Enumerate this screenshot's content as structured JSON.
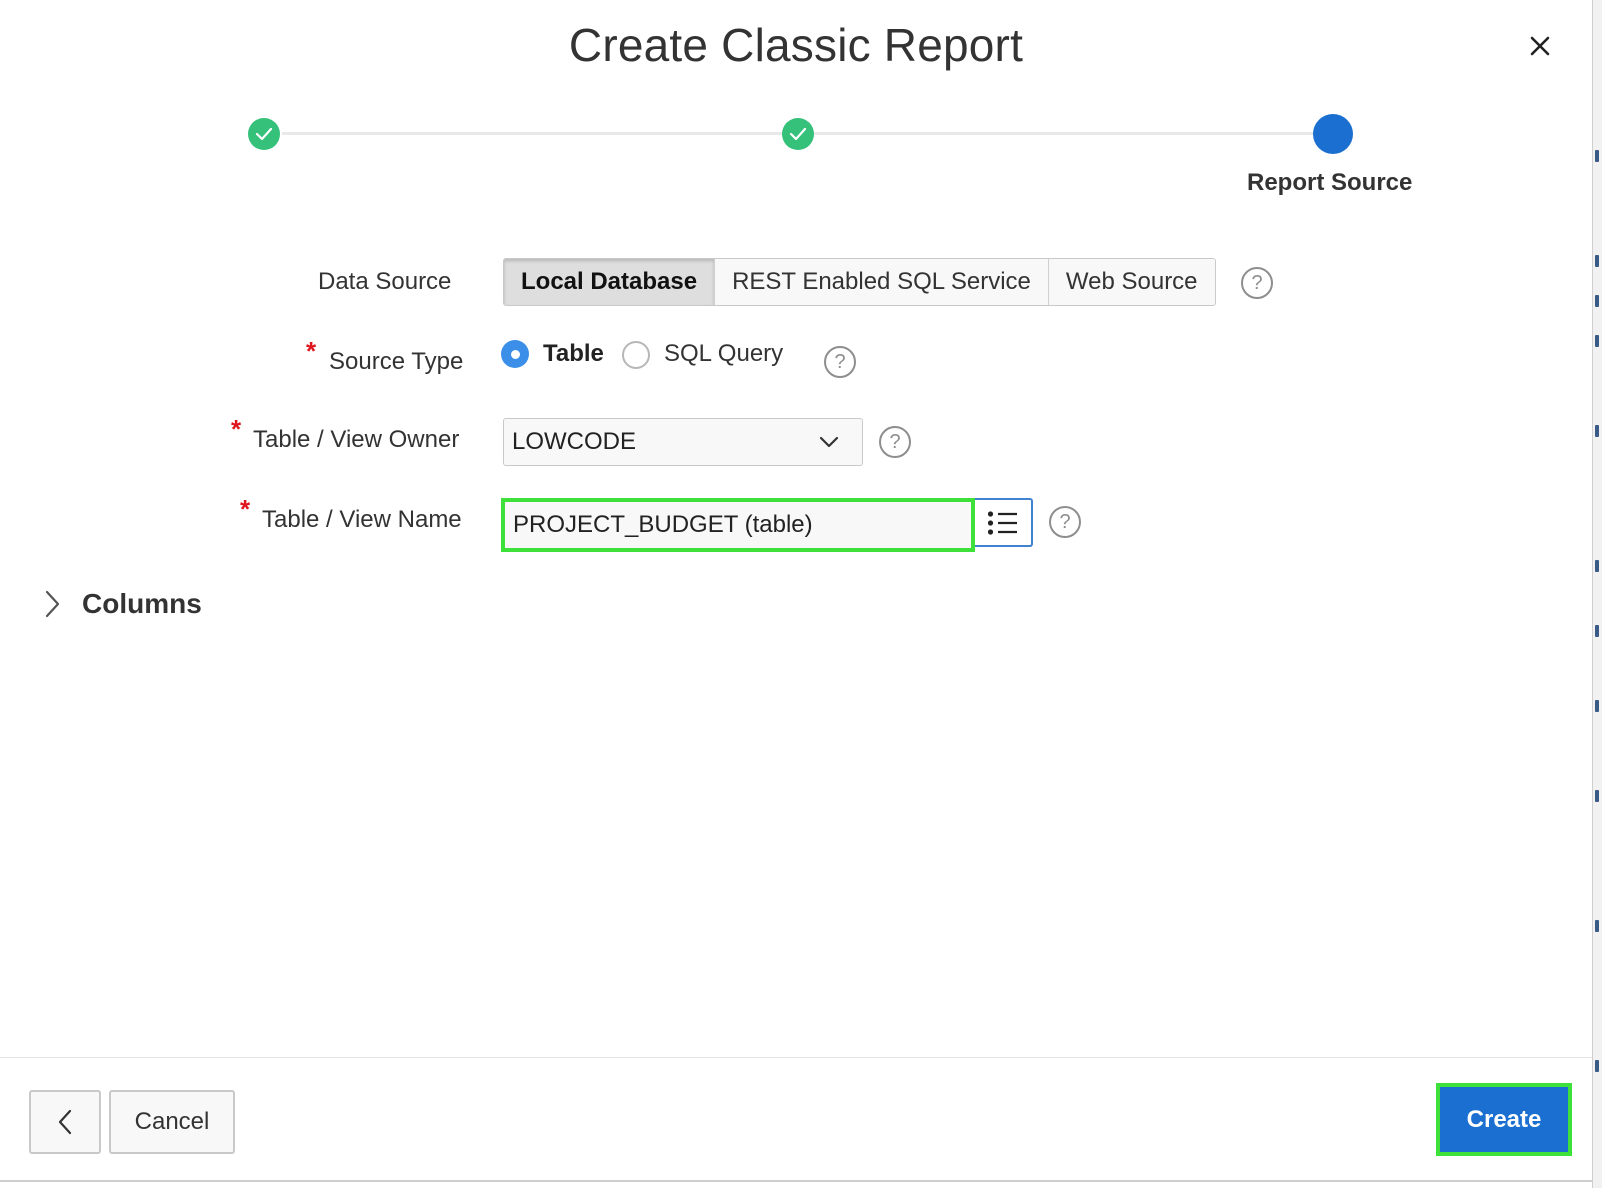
{
  "dialog": {
    "title": "Create Classic Report",
    "close_icon": "close-icon"
  },
  "wizard": {
    "steps": [
      {
        "status": "complete"
      },
      {
        "status": "complete"
      },
      {
        "status": "current",
        "label": "Report Source"
      }
    ],
    "complete_color": "#35c17a",
    "current_color": "#1a6fd0"
  },
  "form": {
    "data_source": {
      "label": "Data Source",
      "options": [
        "Local Database",
        "REST Enabled SQL Service",
        "Web Source"
      ],
      "selected": "Local Database"
    },
    "source_type": {
      "label": "Source Type",
      "required": true,
      "required_mark": "*",
      "options": [
        "Table",
        "SQL Query"
      ],
      "selected": "Table"
    },
    "owner": {
      "label": "Table / View Owner",
      "required": true,
      "required_mark": "*",
      "value": "LOWCODE"
    },
    "name": {
      "label": "Table / View Name",
      "required": true,
      "required_mark": "*",
      "value": "PROJECT_BUDGET (table)"
    },
    "help_glyph": "?"
  },
  "columns_section": {
    "label": "Columns",
    "expanded": false
  },
  "footer": {
    "cancel_label": "Cancel",
    "create_label": "Create",
    "primary_color": "#1a6fd0",
    "highlight_color": "#3ee13a"
  }
}
